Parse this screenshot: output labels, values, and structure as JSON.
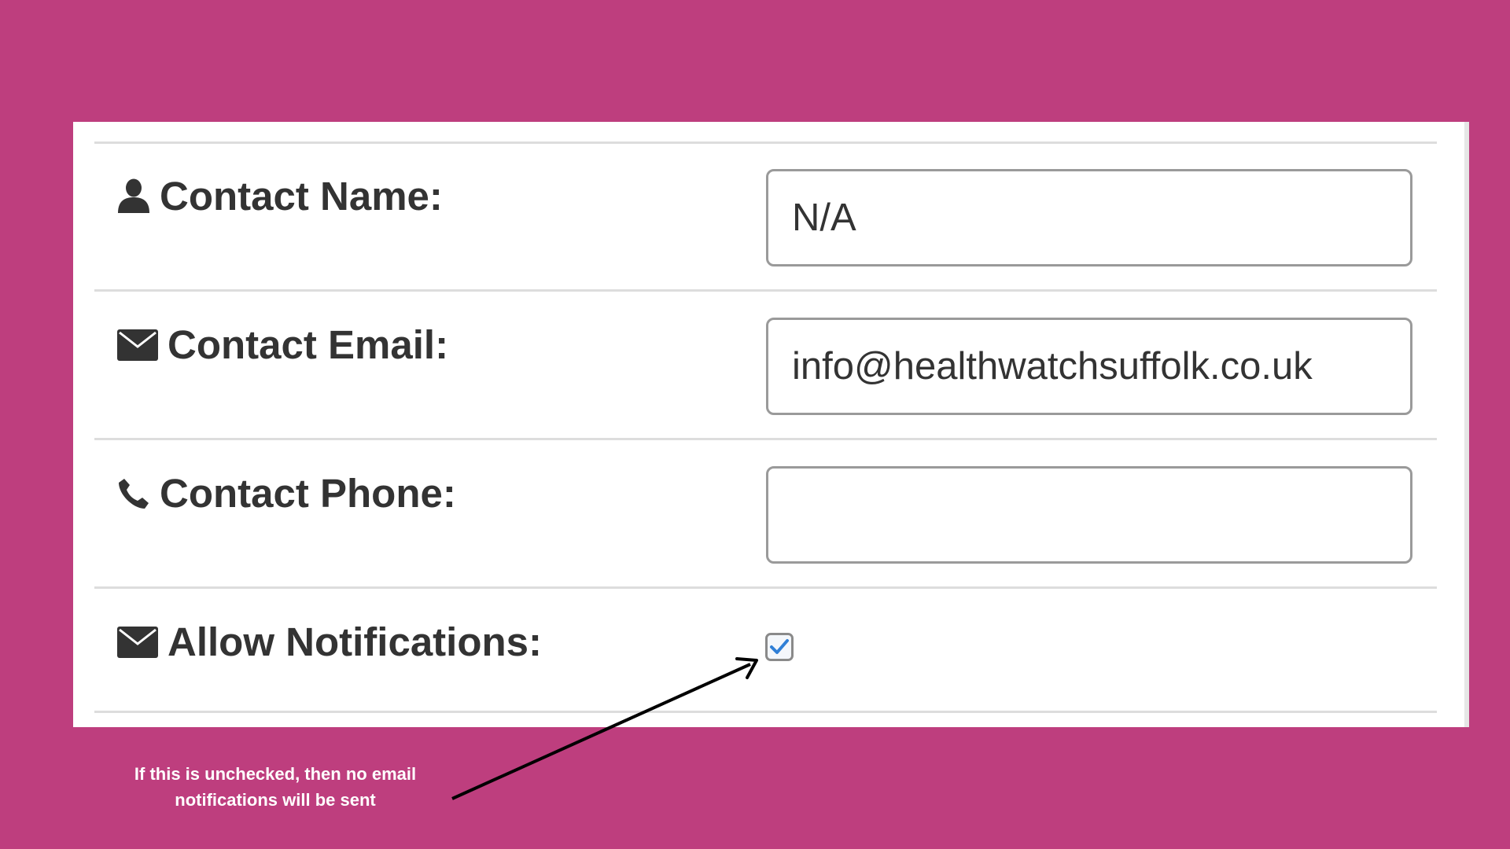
{
  "form": {
    "contact_name": {
      "label": "Contact Name:",
      "icon": "user-icon",
      "value": "N/A"
    },
    "contact_email": {
      "label": "Contact Email:",
      "icon": "envelope-icon",
      "value": "info@healthwatchsuffolk.co.uk"
    },
    "contact_phone": {
      "label": "Contact Phone:",
      "icon": "phone-icon",
      "value": ""
    },
    "allow_notifications": {
      "label": "Allow Notifications:",
      "icon": "envelope-icon",
      "checked": true
    }
  },
  "annotation": {
    "text": "If this is unchecked, then no email notifications will be sent",
    "arrow_color": "#000000"
  },
  "colors": {
    "background": "#be3e7e",
    "panel": "#ffffff",
    "text": "#333333",
    "check_accent": "#2f7fd6"
  }
}
